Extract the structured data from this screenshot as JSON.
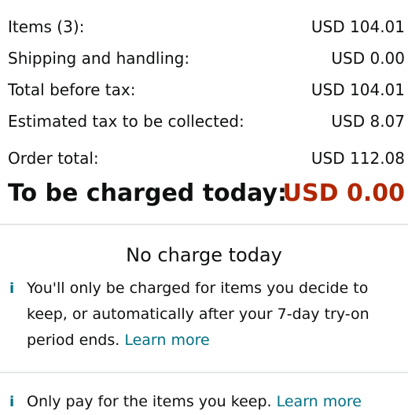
{
  "summary": {
    "items_label": "Items (3):",
    "items_value": "USD 104.01",
    "shipping_label": "Shipping and handling:",
    "shipping_value": "USD 0.00",
    "before_tax_label": "Total before tax:",
    "before_tax_value": "USD 104.01",
    "tax_label": "Estimated tax to be collected:",
    "tax_value": "USD 8.07",
    "order_total_label": "Order total:",
    "order_total_value": "USD 112.08",
    "charged_today_label": "To be charged today:",
    "charged_today_value": "USD 0.00"
  },
  "no_charge": {
    "title": "No charge today",
    "info_icon": "info-icon",
    "message": "You'll only be charged for items you decide to keep, or automatically after your 7-day try-on period ends.",
    "link": "Learn more"
  },
  "pay_notice": {
    "info_icon": "info-icon",
    "message": "Only pay for the items you keep.",
    "link": "Learn more"
  },
  "colors": {
    "accent_link": "#007185",
    "charge_price": "#b12704",
    "divider": "#e3e6e6"
  }
}
